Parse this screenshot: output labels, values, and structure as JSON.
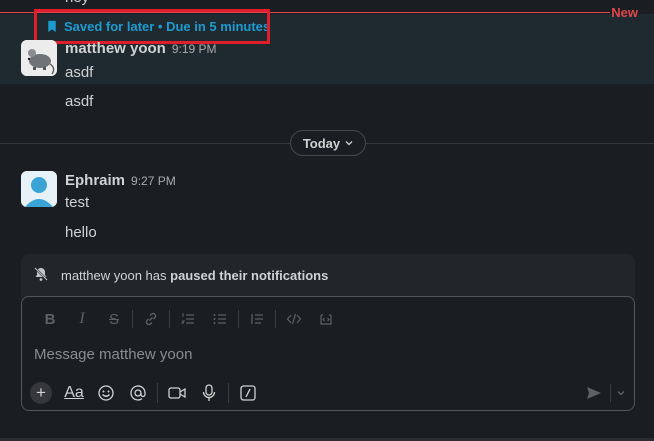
{
  "prev_message_text": "hey",
  "new_divider_label": "New",
  "saved_banner": "Saved for later • Due in 5 minutes",
  "messages": [
    {
      "author": "matthew yoon",
      "time": "9:19 PM",
      "lines": [
        "asdf",
        "asdf"
      ]
    },
    {
      "author": "Ephraim",
      "time": "9:27 PM",
      "lines": [
        "test",
        "hello"
      ]
    }
  ],
  "day_divider": {
    "label": "Today"
  },
  "notification": {
    "prefix": "matthew yoon has ",
    "bold": "paused their notifications"
  },
  "composer": {
    "placeholder": "Message matthew yoon"
  },
  "colors": {
    "accent": "#1d9bd1",
    "new_red": "#e0474b",
    "highlight_red": "#e01e2b",
    "background": "#1a1d21"
  },
  "toolbar_icons": [
    "bold-icon",
    "italic-icon",
    "strikethrough-icon",
    "link-icon",
    "ordered-list-icon",
    "bulleted-list-icon",
    "blockquote-icon",
    "code-icon",
    "code-block-icon"
  ],
  "bottom_icons": [
    "plus-icon",
    "text-format-icon",
    "emoji-icon",
    "mention-icon",
    "video-icon",
    "microphone-icon",
    "slash-command-icon",
    "send-icon",
    "chevron-down-icon"
  ]
}
